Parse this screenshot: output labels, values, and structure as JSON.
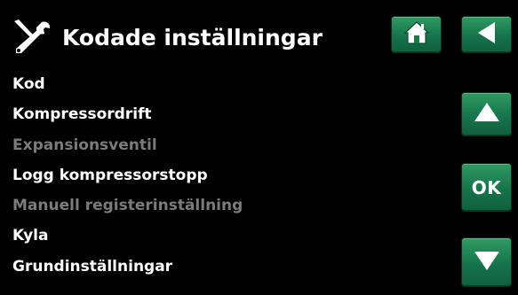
{
  "header": {
    "title": "Kodade inställningar",
    "icon": "tools-icon"
  },
  "nav": {
    "home_icon": "home-icon",
    "back_icon": "back-arrow-icon",
    "up_icon": "arrow-up-icon",
    "ok_label": "OK",
    "down_icon": "arrow-down-icon"
  },
  "menu": {
    "items": [
      {
        "label": "Kod",
        "enabled": true
      },
      {
        "label": "Kompressordrift",
        "enabled": true
      },
      {
        "label": "Expansionsventil",
        "enabled": false
      },
      {
        "label": "Logg kompressorstopp",
        "enabled": true
      },
      {
        "label": "Manuell registerinställning",
        "enabled": false
      },
      {
        "label": "Kyla",
        "enabled": true
      },
      {
        "label": "Grundinställningar",
        "enabled": true
      }
    ]
  },
  "colors": {
    "background": "#000000",
    "text": "#ffffff",
    "disabled_text": "#7b7b7b",
    "button_green": "#16744a"
  }
}
